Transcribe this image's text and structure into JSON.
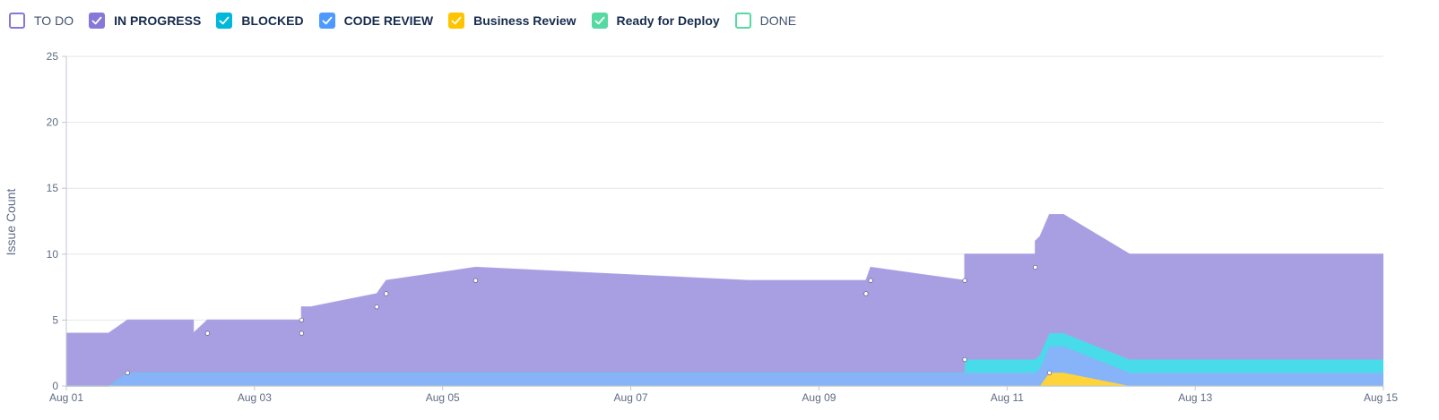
{
  "legend": [
    {
      "label": "TO DO",
      "color": "#8777d9",
      "checked": false
    },
    {
      "label": "IN PROGRESS",
      "color": "#8777d9",
      "checked": true
    },
    {
      "label": "BLOCKED",
      "color": "#00b8d9",
      "checked": true
    },
    {
      "label": "CODE REVIEW",
      "color": "#4c9aff",
      "checked": true
    },
    {
      "label": "Business Review",
      "color": "#ffc400",
      "checked": true
    },
    {
      "label": "Ready for Deploy",
      "color": "#57d9a3",
      "checked": true
    },
    {
      "label": "DONE",
      "color": "#57d9a3",
      "checked": false
    }
  ],
  "chart_data": {
    "type": "area",
    "stacked": true,
    "ylabel": "Issue Count",
    "xlabel": "",
    "ylim": [
      0,
      25
    ],
    "yticks": [
      0,
      5,
      10,
      15,
      20,
      25
    ],
    "xlim": [
      0,
      14
    ],
    "xticks": [
      0,
      2,
      4,
      6,
      8,
      10,
      12,
      14
    ],
    "xtick_labels": [
      "Aug 01",
      "Aug 03",
      "Aug 05",
      "Aug 07",
      "Aug 09",
      "Aug 11",
      "Aug 13",
      "Aug 15"
    ],
    "grid": true,
    "legend_position": "top-left",
    "series": [
      {
        "name": "Ready for Deploy",
        "color": "#57d9a3",
        "points": [
          [
            0,
            0
          ],
          [
            14,
            0
          ]
        ]
      },
      {
        "name": "Business Review",
        "color": "#ffd43b",
        "points": [
          [
            0,
            0
          ],
          [
            10.35,
            0
          ],
          [
            10.45,
            1
          ],
          [
            10.6,
            1
          ],
          [
            11.3,
            0
          ],
          [
            14,
            0
          ]
        ]
      },
      {
        "name": "CODE REVIEW",
        "color": "#87b3f8",
        "points": [
          [
            0,
            0
          ],
          [
            0.45,
            0
          ],
          [
            0.65,
            1
          ],
          [
            10.3,
            1
          ],
          [
            10.45,
            2
          ],
          [
            10.6,
            2
          ],
          [
            11.3,
            1
          ],
          [
            14,
            1
          ]
        ]
      },
      {
        "name": "BLOCKED",
        "color": "#48dbe9",
        "points": [
          [
            0,
            0
          ],
          [
            9.55,
            0
          ],
          [
            9.55,
            1
          ],
          [
            14,
            1
          ]
        ]
      },
      {
        "name": "IN PROGRESS",
        "color": "#a89ee2",
        "points": [
          [
            0,
            4
          ],
          [
            1.35,
            4
          ],
          [
            1.35,
            3
          ],
          [
            1.5,
            4
          ],
          [
            2.5,
            4
          ],
          [
            2.5,
            5
          ],
          [
            2.6,
            5
          ],
          [
            3.3,
            6
          ],
          [
            3.4,
            7
          ],
          [
            4.35,
            8
          ],
          [
            7.25,
            7
          ],
          [
            8.5,
            7
          ],
          [
            8.55,
            8
          ],
          [
            9.55,
            7
          ],
          [
            9.55,
            8
          ],
          [
            10.3,
            8
          ],
          [
            10.3,
            9
          ],
          [
            10.6,
            9
          ],
          [
            11.3,
            8
          ],
          [
            14,
            8
          ]
        ]
      }
    ],
    "markers": [
      [
        0.65,
        1
      ],
      [
        1.5,
        4
      ],
      [
        2.5,
        5
      ],
      [
        2.5,
        4
      ],
      [
        3.3,
        6
      ],
      [
        3.4,
        7
      ],
      [
        4.35,
        8
      ],
      [
        8.5,
        7
      ],
      [
        8.55,
        8
      ],
      [
        9.55,
        8
      ],
      [
        9.55,
        2
      ],
      [
        10.3,
        9
      ],
      [
        10.45,
        1
      ]
    ]
  }
}
